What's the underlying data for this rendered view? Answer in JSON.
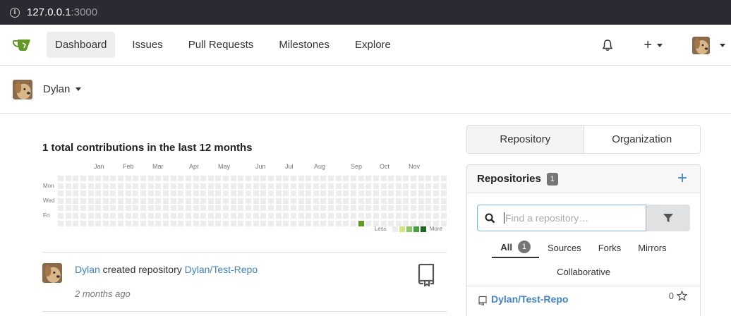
{
  "browser": {
    "url_host": "127.0.0.1",
    "url_port": ":3000"
  },
  "nav": {
    "items": [
      "Dashboard",
      "Issues",
      "Pull Requests",
      "Milestones",
      "Explore"
    ],
    "active_index": 0,
    "icons": [
      "gitea-logo",
      "bell-icon",
      "plus-icon",
      "avatar"
    ]
  },
  "user": {
    "name": "Dylan"
  },
  "heatmap": {
    "title": "1 total contributions in the last 12 months",
    "months": [
      "Jan",
      "Feb",
      "Mar",
      "Apr",
      "May",
      "Jun",
      "Jul",
      "Aug",
      "Sep",
      "Oct",
      "Nov"
    ],
    "days": [
      "Mon",
      "Wed",
      "Fri"
    ],
    "weeks": 52,
    "contribution": {
      "week": 40,
      "day": 6,
      "count": 1
    },
    "legend_less": "Less",
    "legend_more": "More",
    "colors": [
      "#ededed",
      "#d6e685",
      "#8cc665",
      "#44a340",
      "#1e6823"
    ],
    "accent": "#609926"
  },
  "feed": [
    {
      "user": "Dylan",
      "action": " created repository ",
      "repo": "Dylan/Test-Repo",
      "time": "2 months ago"
    }
  ],
  "sidebar": {
    "tabs": [
      "Repository",
      "Organization"
    ],
    "active_tab": 0,
    "panel_title": "Repositories",
    "panel_count": "1",
    "search_placeholder": "Find a repository…",
    "filters": [
      "All",
      "Sources",
      "Forks",
      "Mirrors"
    ],
    "all_count": "1",
    "filter_extra": "Collaborative",
    "repos": [
      {
        "name": "Dylan/Test-Repo",
        "stars": "0"
      }
    ]
  },
  "colors": {
    "link": "#4183c4",
    "border": "#dddddd"
  }
}
